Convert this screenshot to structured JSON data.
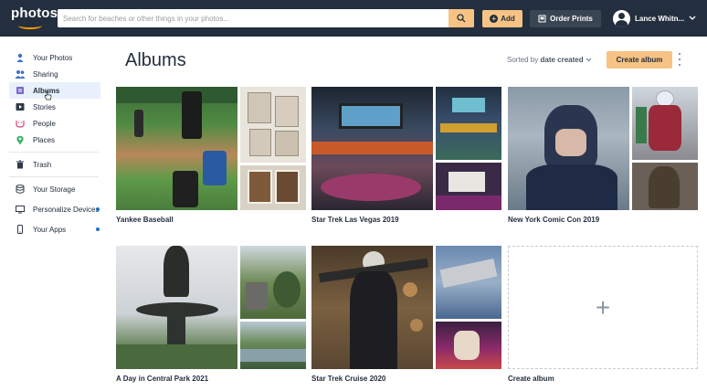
{
  "app": {
    "logo_text": "photos",
    "search_placeholder": "Search for beaches or other things in your photos...",
    "add_label": "Add",
    "order_prints_label": "Order Prints",
    "user_name": "Lance Whitn..."
  },
  "sidebar": {
    "items": [
      {
        "label": "Your Photos",
        "icon": "person-icon"
      },
      {
        "label": "Sharing",
        "icon": "people-icon"
      },
      {
        "label": "Albums",
        "icon": "album-icon",
        "active": true
      },
      {
        "label": "Stories",
        "icon": "play-icon"
      },
      {
        "label": "People",
        "icon": "face-icon"
      },
      {
        "label": "Places",
        "icon": "pin-icon"
      },
      {
        "label": "Trash",
        "icon": "trash-icon"
      },
      {
        "label": "Your Storage",
        "icon": "database-icon"
      },
      {
        "label": "Personalize Devices",
        "icon": "monitor-icon",
        "dot": true
      },
      {
        "label": "Your Apps",
        "icon": "phone-icon",
        "dot": true
      }
    ]
  },
  "main": {
    "title": "Albums",
    "sort_prefix": "Sorted by",
    "sort_value": "date created",
    "create_album_label": "Create album"
  },
  "albums": [
    {
      "title": "Yankee Baseball"
    },
    {
      "title": "Star Trek Las Vegas 2019"
    },
    {
      "title": "New York Comic Con 2019"
    },
    {
      "title": "A Day in Central Park 2021"
    },
    {
      "title": "Star Trek Cruise 2020"
    },
    {
      "title": "Create album",
      "placeholder": "+"
    }
  ],
  "colors": {
    "topbar": "#232f3e",
    "accent": "#f7c384",
    "active_bg": "#e8f1fb",
    "dot": "#1a73c8"
  }
}
